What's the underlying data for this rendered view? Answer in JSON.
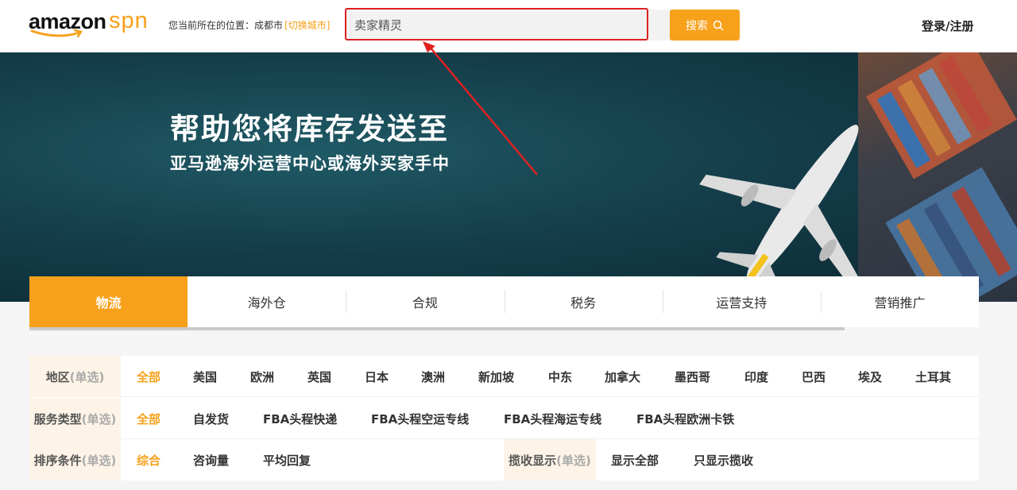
{
  "header": {
    "logo_main": "amazon",
    "logo_sub": "spn",
    "location_label": "您当前所在的位置：成都市",
    "switch_city": "[切换城市]",
    "search_placeholder": "卖家精灵",
    "search_button": "搜索",
    "login": "登录/注册"
  },
  "banner": {
    "headline": "帮助您将库存发送至",
    "subline": "亚马逊海外运营中心或海外买家手中"
  },
  "tabs": [
    {
      "label": "物流",
      "active": true
    },
    {
      "label": "海外仓"
    },
    {
      "label": "合规"
    },
    {
      "label": "税务"
    },
    {
      "label": "运营支持"
    },
    {
      "label": "营销推广"
    }
  ],
  "filters": {
    "region": {
      "label": "地区",
      "mode": "(单选)",
      "options": [
        "全部",
        "美国",
        "欧洲",
        "英国",
        "日本",
        "澳洲",
        "新加坡",
        "中东",
        "加拿大",
        "墨西哥",
        "印度",
        "巴西",
        "埃及",
        "土耳其"
      ],
      "selected": "全部"
    },
    "service": {
      "label": "服务类型",
      "mode": "(单选)",
      "options": [
        "全部",
        "自发货",
        "FBA头程快递",
        "FBA头程空运专线",
        "FBA头程海运专线",
        "FBA头程欧洲卡铁"
      ],
      "selected": "全部"
    },
    "sort": {
      "label": "排序条件",
      "mode": "(单选)",
      "options": [
        "综合",
        "咨询量",
        "平均回复"
      ],
      "selected": "综合"
    },
    "pickup": {
      "label": "揽收显示",
      "mode": "(单选)",
      "options": [
        "显示全部",
        "只显示揽收"
      ]
    }
  },
  "colors": {
    "accent": "#f7a11a",
    "highlight": "#e02020"
  }
}
